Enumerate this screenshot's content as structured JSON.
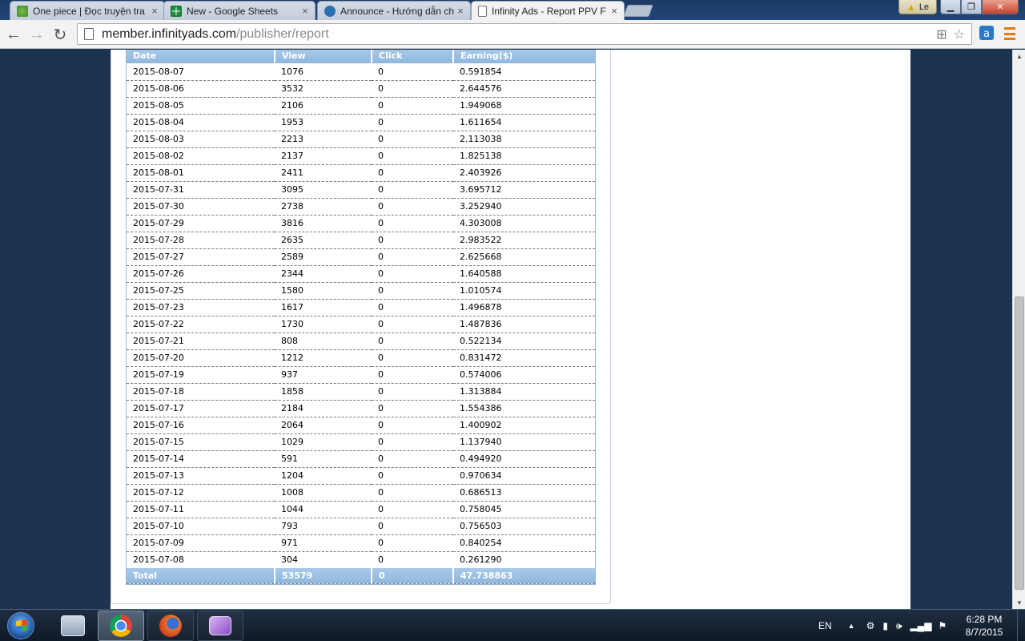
{
  "browser": {
    "tabs": [
      {
        "label": "One piece | Đọc truyện tra",
        "icon": "leaf-icon",
        "active": false
      },
      {
        "label": "New - Google Sheets",
        "icon": "sheets-icon",
        "active": false
      },
      {
        "label": "Announce - Hướng dẫn ch",
        "icon": "s-logo-icon",
        "active": false
      },
      {
        "label": "Infinity Ads - Report PPV F",
        "icon": "page-icon",
        "active": true
      }
    ],
    "tab_close_glyph": "×",
    "user_name": "Le",
    "url_host": "member.infinityads.com",
    "url_path": "/publisher/report"
  },
  "report": {
    "columns": [
      "Date",
      "View",
      "Click",
      "Earning($)"
    ],
    "rows": [
      [
        "2015-08-07",
        "1076",
        "0",
        "0.591854"
      ],
      [
        "2015-08-06",
        "3532",
        "0",
        "2.644576"
      ],
      [
        "2015-08-05",
        "2106",
        "0",
        "1.949068"
      ],
      [
        "2015-08-04",
        "1953",
        "0",
        "1.611654"
      ],
      [
        "2015-08-03",
        "2213",
        "0",
        "2.113038"
      ],
      [
        "2015-08-02",
        "2137",
        "0",
        "1.825138"
      ],
      [
        "2015-08-01",
        "2411",
        "0",
        "2.403926"
      ],
      [
        "2015-07-31",
        "3095",
        "0",
        "3.695712"
      ],
      [
        "2015-07-30",
        "2738",
        "0",
        "3.252940"
      ],
      [
        "2015-07-29",
        "3816",
        "0",
        "4.303008"
      ],
      [
        "2015-07-28",
        "2635",
        "0",
        "2.983522"
      ],
      [
        "2015-07-27",
        "2589",
        "0",
        "2.625668"
      ],
      [
        "2015-07-26",
        "2344",
        "0",
        "1.640588"
      ],
      [
        "2015-07-25",
        "1580",
        "0",
        "1.010574"
      ],
      [
        "2015-07-23",
        "1617",
        "0",
        "1.496878"
      ],
      [
        "2015-07-22",
        "1730",
        "0",
        "1.487836"
      ],
      [
        "2015-07-21",
        "808",
        "0",
        "0.522134"
      ],
      [
        "2015-07-20",
        "1212",
        "0",
        "0.831472"
      ],
      [
        "2015-07-19",
        "937",
        "0",
        "0.574006"
      ],
      [
        "2015-07-18",
        "1858",
        "0",
        "1.313884"
      ],
      [
        "2015-07-17",
        "2184",
        "0",
        "1.554386"
      ],
      [
        "2015-07-16",
        "2064",
        "0",
        "1.400902"
      ],
      [
        "2015-07-15",
        "1029",
        "0",
        "1.137940"
      ],
      [
        "2015-07-14",
        "591",
        "0",
        "0.494920"
      ],
      [
        "2015-07-13",
        "1204",
        "0",
        "0.970634"
      ],
      [
        "2015-07-12",
        "1008",
        "0",
        "0.686513"
      ],
      [
        "2015-07-11",
        "1044",
        "0",
        "0.758045"
      ],
      [
        "2015-07-10",
        "793",
        "0",
        "0.756503"
      ],
      [
        "2015-07-09",
        "971",
        "0",
        "0.840254"
      ],
      [
        "2015-07-08",
        "304",
        "0",
        "0.261290"
      ]
    ],
    "total": [
      "Total",
      "53579",
      "0",
      "47.738863"
    ]
  },
  "taskbar": {
    "apps": [
      {
        "name": "network-app-icon"
      },
      {
        "name": "chrome-icon",
        "active": true
      },
      {
        "name": "firefox-icon"
      },
      {
        "name": "paint-app-icon"
      }
    ],
    "language": "EN",
    "time": "6:28 PM",
    "date": "8/7/2015"
  }
}
